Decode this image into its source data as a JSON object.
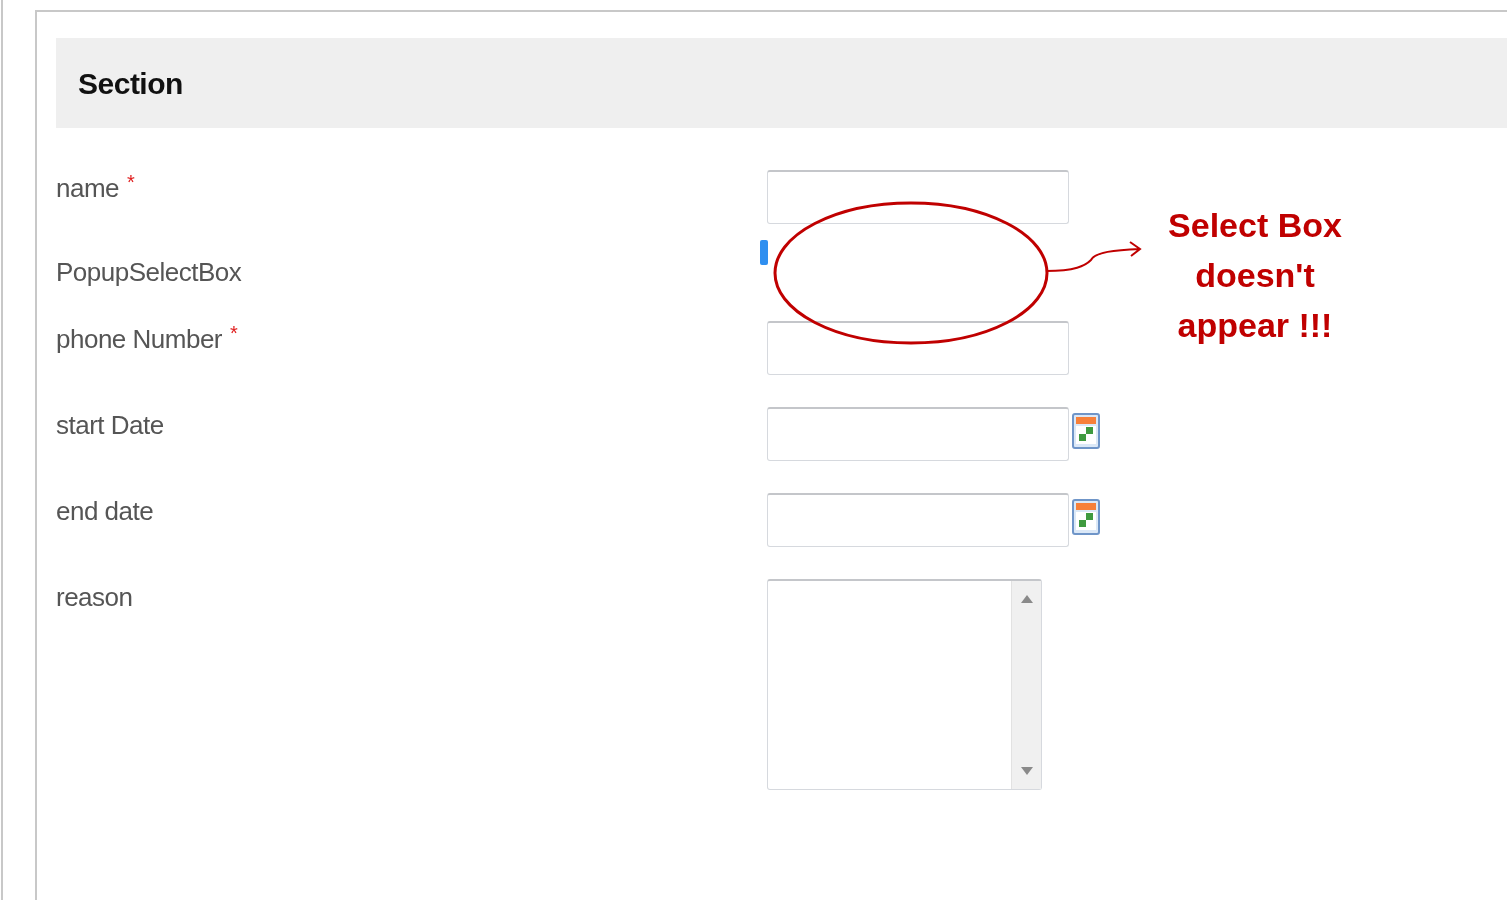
{
  "section": {
    "title": "Section"
  },
  "fields": [
    {
      "label": "name",
      "kind": "text",
      "required_mark": "*"
    },
    {
      "label": "PopupSelectBox",
      "kind": "popup"
    },
    {
      "label": "phone Number",
      "kind": "text",
      "required_mark": "*"
    },
    {
      "label": "start Date",
      "kind": "date"
    },
    {
      "label": "end date",
      "kind": "date"
    },
    {
      "label": "reason",
      "kind": "textarea"
    }
  ],
  "annotation": {
    "text": "Select Box doesn't appear !!!"
  }
}
